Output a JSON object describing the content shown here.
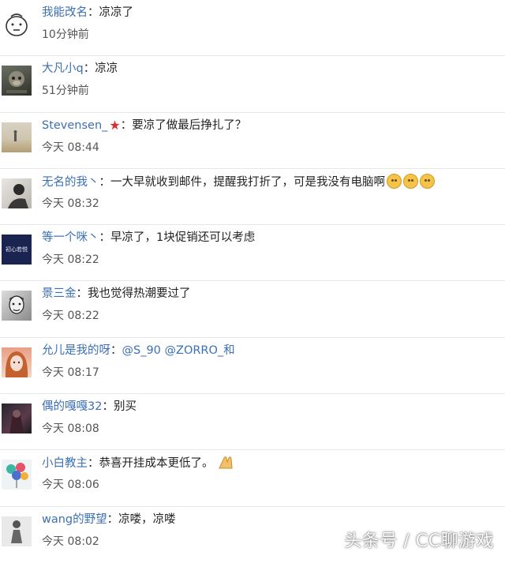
{
  "comments": [
    {
      "username": "我能改名",
      "text": "凉凉了",
      "time": "10分钟前",
      "avatar": "face-outline-avatar"
    },
    {
      "username": "大凡小q",
      "text": "凉凉",
      "time": "51分钟前",
      "avatar": "photo-avatar"
    },
    {
      "username": "Stevensen_",
      "text": "要凉了做最后挣扎了？",
      "time": "今天 08:44",
      "avatar": "photo-avatar"
    },
    {
      "username": "无名的我丶",
      "text": "一大早就收到邮件，提醒我打折了，可是我没有电脑啊",
      "time": "今天 08:32",
      "avatar": "photo-avatar"
    },
    {
      "username": "等一个咪丶",
      "text": "早凉了，1块促销还可以考虑",
      "time": "今天 08:22",
      "avatar": "photo-avatar"
    },
    {
      "username": "景三金",
      "text": "我也觉得热潮要过了",
      "time": "今天 08:22",
      "avatar": "photo-avatar"
    },
    {
      "username": "允儿是我的呀",
      "text": "@S_90 @ZORRO_和",
      "time": "今天 08:17",
      "avatar": "photo-avatar"
    },
    {
      "username": "偶的嘎嘎32",
      "text": "别买",
      "time": "今天 08:08",
      "avatar": "photo-avatar"
    },
    {
      "username": "小白教主",
      "text": "恭喜开挂成本更低了。",
      "time": "今天 08:06",
      "avatar": "photo-avatar"
    },
    {
      "username": "wang的野望",
      "text": "凉喽，凉喽",
      "time": "今天 08:02",
      "avatar": "photo-avatar"
    }
  ],
  "separator": "：",
  "avatar_text_5": "初心若悦",
  "watermark": "头条号 / CC聊游戏",
  "colors": {
    "username": "#3b6fb6",
    "text": "#222222",
    "time": "#555555",
    "divider": "#e6e6e6"
  }
}
